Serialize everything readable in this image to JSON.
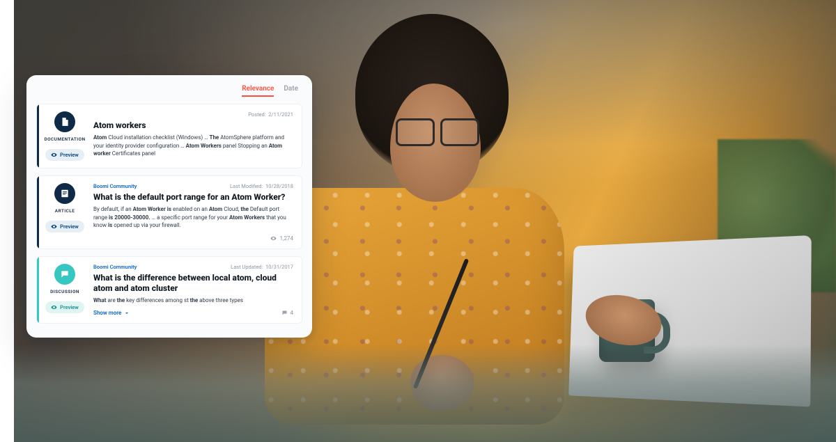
{
  "sort": {
    "relevance": "Relevance",
    "date": "Date",
    "active": "relevance"
  },
  "common": {
    "preview_label": "Preview",
    "show_more_label": "Show more"
  },
  "results": [
    {
      "type": "DOCUMENTATION",
      "date_label": "Posted:",
      "date": "2/11/2021",
      "title": "Atom workers",
      "snippet_html": "<b>Atom</b> Cloud installation checklist (Windows) … <b>The</b> AtomSphere platform and your identity provider configuration … <b>Atom Workers</b> panel Stopping an <b>Atom worker</b> Certificates panel"
    },
    {
      "type": "ARTICLE",
      "source": "Boomi Community",
      "date_label": "Last Modified:",
      "date": "10/28/2018",
      "title": "What is the default port range for an Atom Worker?",
      "snippet_html": "By default, if an <b>Atom Worker is</b> enabled on an <b>Atom</b> Cloud, <b>the</b> Default port range <b>is 20000-30000.</b> … a specific port range for your <b>Atom Workers</b> that you know <b>is</b> opened up via your firewall.",
      "views": "1,274"
    },
    {
      "type": "DISCUSSION",
      "source": "Boomi Community",
      "date_label": "Last Updated:",
      "date": "10/31/2017",
      "title": "What is the difference between local atom, cloud atom and atom cluster",
      "snippet_html": "<b>What</b> are <b>the</b> key differences among st <b>the</b> above three types",
      "replies": "4"
    }
  ]
}
